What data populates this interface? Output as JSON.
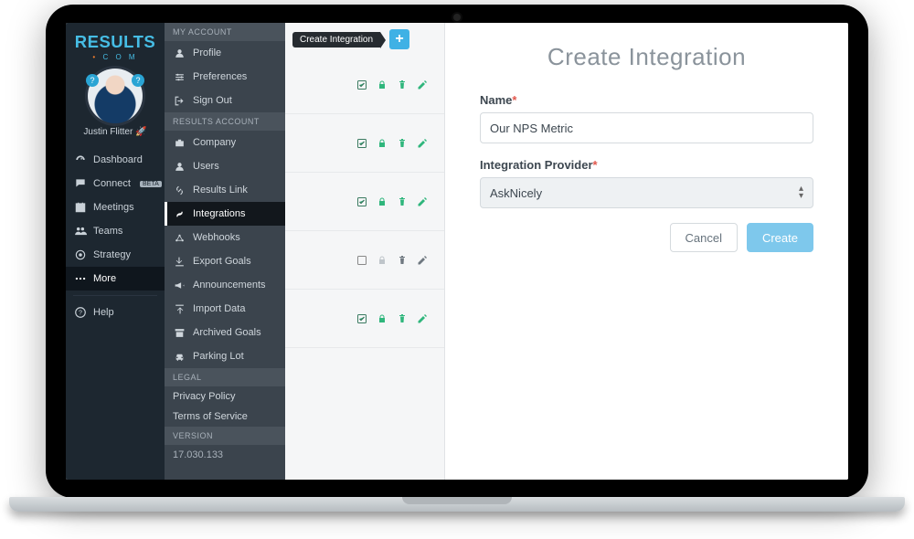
{
  "brand": {
    "line1": "RESULTS",
    "line2": "C O M"
  },
  "user": {
    "name": "Justin Flitter",
    "emoji": "🚀"
  },
  "primary_nav": {
    "items": [
      {
        "label": "Dashboard",
        "icon": "gauge-icon"
      },
      {
        "label": "Connect",
        "icon": "chat-icon",
        "badge": "BETA"
      },
      {
        "label": "Meetings",
        "icon": "calendar-icon"
      },
      {
        "label": "Teams",
        "icon": "people-icon"
      },
      {
        "label": "Strategy",
        "icon": "target-icon"
      },
      {
        "label": "More",
        "icon": "dots-icon",
        "active": true
      }
    ],
    "help_label": "Help"
  },
  "secondary_nav": {
    "sections": [
      {
        "title": "MY ACCOUNT",
        "items": [
          {
            "label": "Profile",
            "icon": "person-icon"
          },
          {
            "label": "Preferences",
            "icon": "sliders-icon"
          },
          {
            "label": "Sign Out",
            "icon": "signout-icon"
          }
        ]
      },
      {
        "title": "RESULTS ACCOUNT",
        "items": [
          {
            "label": "Company",
            "icon": "briefcase-icon"
          },
          {
            "label": "Users",
            "icon": "person-icon"
          },
          {
            "label": "Results Link",
            "icon": "link-icon"
          },
          {
            "label": "Integrations",
            "icon": "integrations-icon",
            "active": true
          },
          {
            "label": "Webhooks",
            "icon": "webhook-icon"
          },
          {
            "label": "Export Goals",
            "icon": "download-icon"
          },
          {
            "label": "Announcements",
            "icon": "megaphone-icon"
          },
          {
            "label": "Import Data",
            "icon": "upload-icon"
          },
          {
            "label": "Archived Goals",
            "icon": "archive-icon"
          },
          {
            "label": "Parking Lot",
            "icon": "car-icon"
          }
        ]
      },
      {
        "title": "LEGAL",
        "items": [
          {
            "label": "Privacy Policy"
          },
          {
            "label": "Terms of Service"
          }
        ]
      },
      {
        "title": "VERSION",
        "items": [
          {
            "label": "17.030.133"
          }
        ]
      }
    ]
  },
  "integration_list": {
    "create_label": "Create Integration",
    "rows": [
      {
        "checked": true,
        "locked": true,
        "hasDelete": true,
        "hasEdit": true
      },
      {
        "checked": true,
        "locked": true,
        "hasDelete": true,
        "hasEdit": true
      },
      {
        "checked": true,
        "locked": true,
        "hasDelete": true,
        "hasEdit": true
      },
      {
        "checked": false,
        "locked": false,
        "hasDelete": true,
        "hasEdit": true
      },
      {
        "checked": true,
        "locked": true,
        "hasDelete": true,
        "hasEdit": true
      }
    ]
  },
  "form": {
    "title": "Create Integration",
    "name_label": "Name",
    "name_value": "Our NPS Metric",
    "provider_label": "Integration Provider",
    "provider_value": "AskNicely",
    "cancel_label": "Cancel",
    "create_label": "Create"
  },
  "colors": {
    "accent": "#46bde5",
    "success": "#2fb67c",
    "danger": "#e2574c"
  }
}
